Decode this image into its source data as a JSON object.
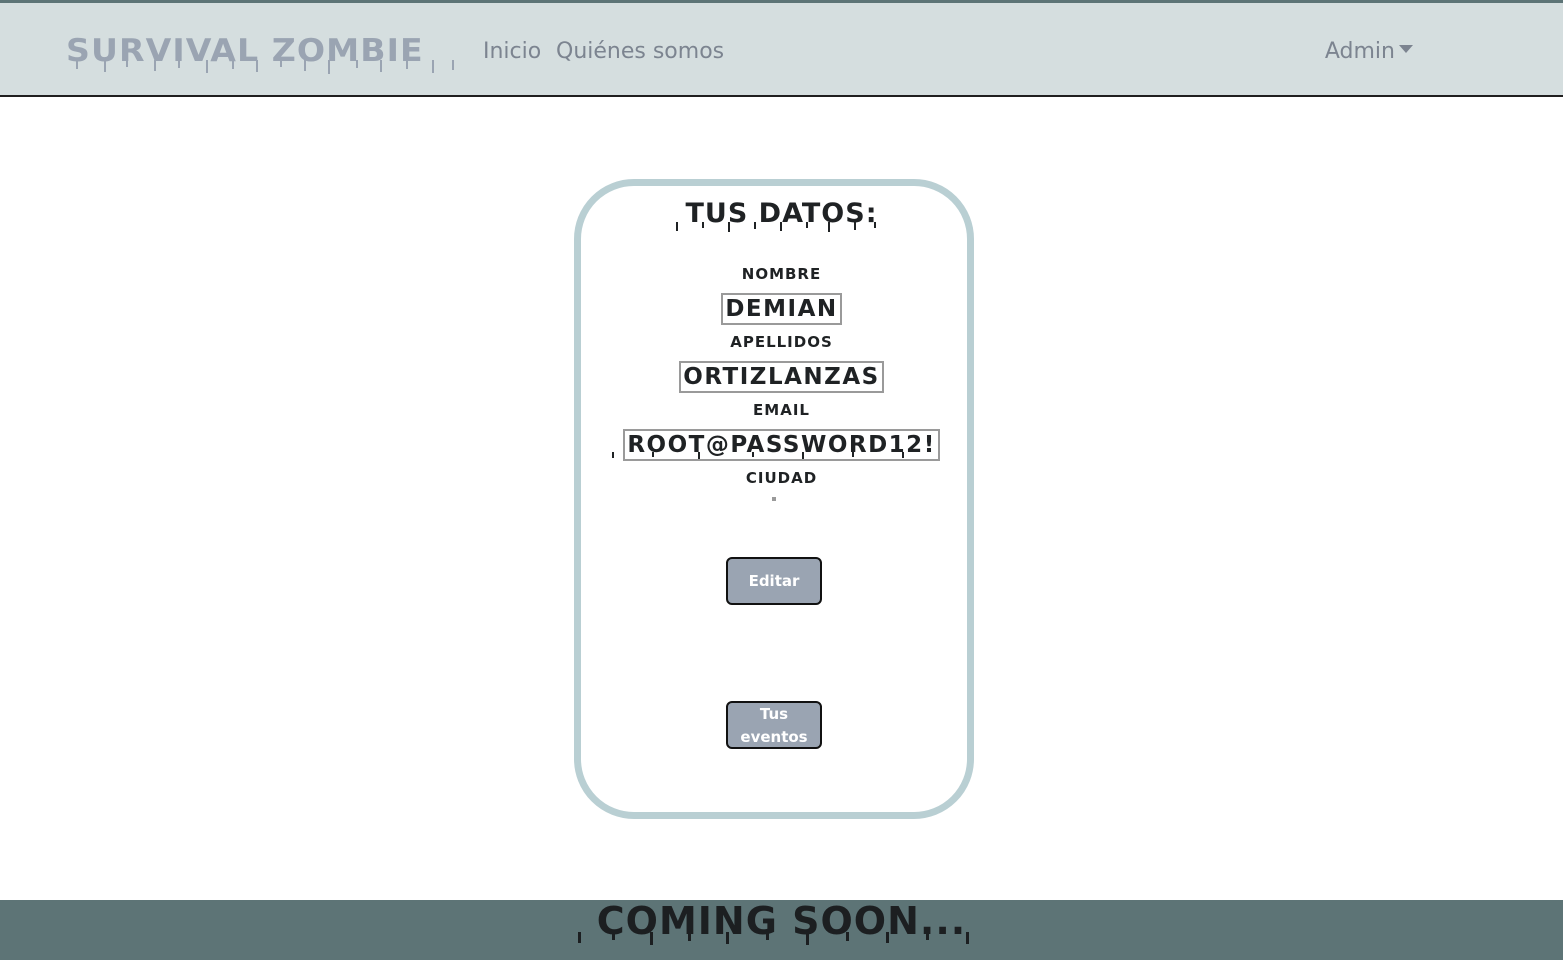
{
  "navbar": {
    "brand": "SURVIVAL ZOMBIE",
    "links": [
      "Inicio",
      "Quiénes somos"
    ],
    "user_menu": "Admin"
  },
  "profile": {
    "title": "TUS DATOS:",
    "fields": [
      {
        "label": "NOMBRE",
        "value": "DEMIAN"
      },
      {
        "label": "APELLIDOS",
        "value": "ORTIZLANZAS"
      },
      {
        "label": "EMAIL",
        "value": "ROOT@PASSWORD12!"
      },
      {
        "label": "CIUDAD",
        "value": ""
      }
    ],
    "edit_button": "Editar",
    "events_button": "Tus eventos"
  },
  "footer": {
    "text": "COMING SOON..."
  },
  "colors": {
    "navbar_bg": "#d5dedf",
    "brand": "#9aa4b2",
    "card_border": "#b9cfd3",
    "button_bg": "#9aa4b2",
    "footer_bg": "#5d7476"
  }
}
